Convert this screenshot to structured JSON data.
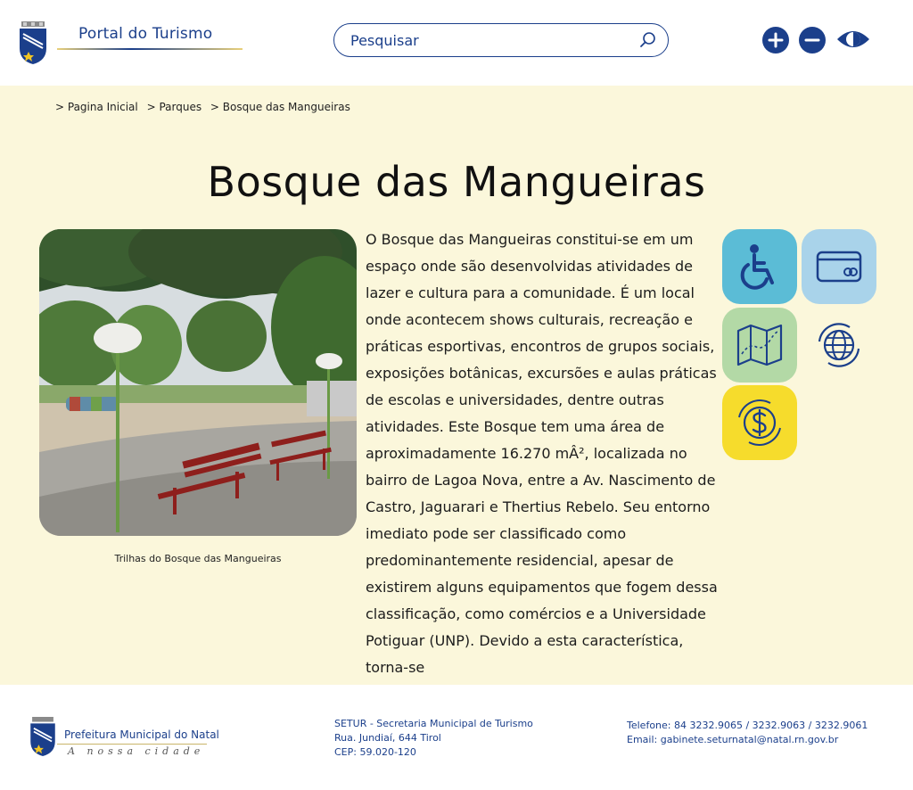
{
  "header": {
    "portal_title": "Portal do Turismo",
    "search_placeholder": "Pesquisar",
    "accessibility": {
      "increase_label": "+",
      "decrease_label": "−"
    }
  },
  "breadcrumb": [
    "> Pagina Inicial",
    "> Parques",
    "> Bosque das Mangueiras"
  ],
  "page_title": "Bosque das Mangueiras",
  "photo_caption": "Trilhas do Bosque das Mangueiras",
  "description": "O Bosque das Mangueiras constitui-se em um espaço onde são desenvolvidas atividades de lazer e cultura para a comunidade. É um local onde acontecem shows culturais, recreação e práticas esportivas, encontros de grupos sociais, exposições botânicas, excursões e aulas práticas de escolas e universidades, dentre outras atividades. Este Bosque tem uma área de aproximadamente 16.270 mÂ², localizada no bairro de Lagoa Nova, entre a Av. Nascimento de Castro, Jaguarari e Thertius Rebelo. Seu entorno imediato pode ser classificado como predominantemente residencial, apesar de existirem alguns equipamentos que fogem dessa classificação, como comércios e a Universidade Potiguar (UNP). Devido a esta característica, torna-se",
  "feature_tiles": [
    {
      "icon": "wheelchair-icon",
      "color": "#5bbcd6"
    },
    {
      "icon": "credit-card-icon",
      "color": "#a9d3ea"
    },
    {
      "icon": "map-icon",
      "color": "#b3d9a6"
    },
    {
      "icon": "globe-icon",
      "color": "#fbf7db"
    },
    {
      "icon": "dollar-icon",
      "color": "#f6dc2c"
    }
  ],
  "footer": {
    "brand": "Prefeitura Municipal do Natal",
    "tagline": "A nossa cidade",
    "address_lines": [
      "SETUR - Secretaria Municipal de Turismo",
      "Rua. Jundiaí, 644 Tirol",
      "CEP: 59.020-120"
    ],
    "phone": "Telefone: 84 3232.9065 / 3232.9063 / 3232.9061",
    "email": "Email: gabinete.seturnatal@natal.rn.gov.br"
  },
  "colors": {
    "brand_blue": "#1b3f8b",
    "content_background": "#fbf7db"
  }
}
